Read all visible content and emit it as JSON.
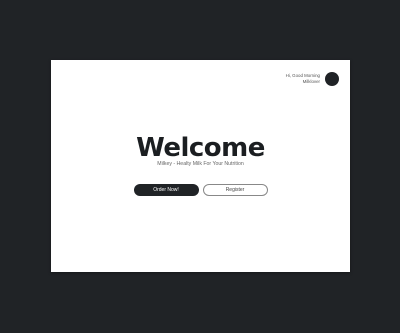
{
  "user": {
    "greeting": "Hi, Good Morning",
    "username": "Milklover"
  },
  "hero": {
    "title": "Welcome",
    "subtitle": "Milkey - Healty Milk For Your Nutrition"
  },
  "actions": {
    "order_label": "Order Now!",
    "register_label": "Register"
  },
  "colors": {
    "background": "#202326",
    "card": "#ffffff",
    "primary_button": "#202326"
  }
}
